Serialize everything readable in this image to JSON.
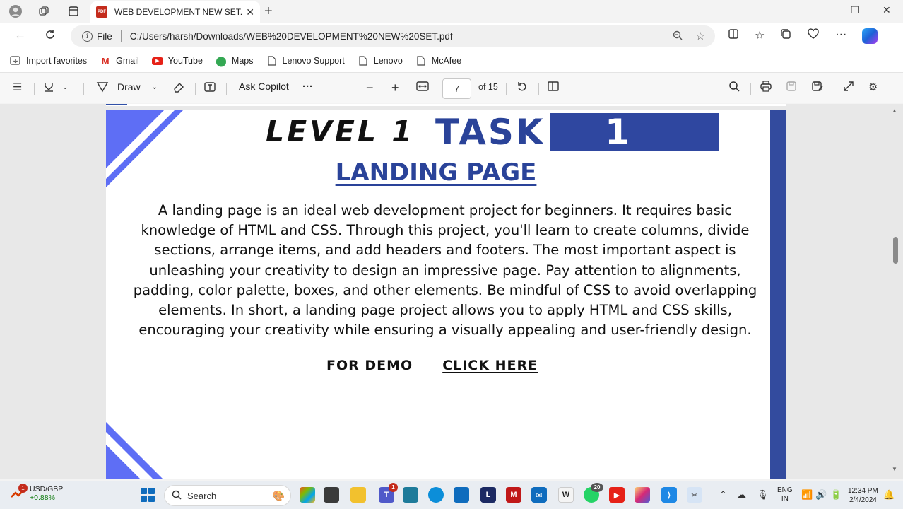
{
  "browser": {
    "tab_title": "WEB DEVELOPMENT NEW SET.p",
    "address_label": "File",
    "url": "C:/Users/harsh/Downloads/WEB%20DEVELOPMENT%20NEW%20SET.pdf",
    "favorites": [
      {
        "label": "Import favorites",
        "icon": "import-icon"
      },
      {
        "label": "Gmail",
        "icon": "gmail-icon"
      },
      {
        "label": "YouTube",
        "icon": "youtube-icon"
      },
      {
        "label": "Maps",
        "icon": "maps-icon"
      },
      {
        "label": "Lenovo Support",
        "icon": "page-icon"
      },
      {
        "label": "Lenovo",
        "icon": "page-icon"
      },
      {
        "label": "McAfee",
        "icon": "page-icon"
      }
    ]
  },
  "pdf_toolbar": {
    "draw_label": "Draw",
    "ask_copilot_label": "Ask Copilot",
    "more_label": "···",
    "page_current": "7",
    "page_total": "of 15"
  },
  "document": {
    "level_text": "LEVEL 1",
    "task_text": "TASK",
    "task_number": "1",
    "heading": "LANDING PAGE",
    "description": "A landing page is an ideal web development project for beginners. It requires basic knowledge of HTML and CSS. Through this project, you'll learn to create columns, divide sections, arrange items, and add headers and footers. The most important aspect is unleashing your creativity to design an impressive page. Pay attention to alignments, padding, color palette, boxes, and other elements. Be mindful of CSS to avoid overlapping elements. In short, a landing page project allows you to apply HTML and CSS skills, encouraging your creativity while ensuring a visually appealing and user-friendly design.",
    "demo_label": "FOR DEMO",
    "demo_link": "CLICK HERE",
    "accent_color": "#2f47a0"
  },
  "taskbar": {
    "stock_name": "USD/GBP",
    "stock_change": "+0.88%",
    "stock_notification": "1",
    "search_placeholder": "Search",
    "teams_badge": "1",
    "whatsapp_badge": "20",
    "lang_line1": "ENG",
    "lang_line2": "IN",
    "time": "12:34 PM",
    "date": "2/4/2024"
  }
}
